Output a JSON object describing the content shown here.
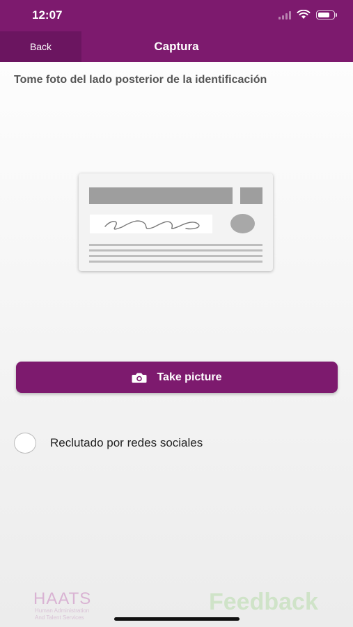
{
  "status_bar": {
    "time": "12:07",
    "signal_bars_filled": 0,
    "battery_level": 0.8
  },
  "nav": {
    "back_label": "Back",
    "title": "Captura"
  },
  "instruction": "Tome foto del lado posterior de la identificación",
  "illustration": {
    "icon": "id-card-back-icon"
  },
  "take_picture": {
    "label": "Take picture",
    "icon": "camera-icon"
  },
  "checkbox": {
    "label": "Reclutado por redes sociales",
    "checked": false
  },
  "footer": {
    "haats_name": "HAATS",
    "haats_tagline_1": "Human Administration",
    "haats_tagline_2": "And Talent Services",
    "feedback_brand": "Feedback"
  },
  "colors": {
    "brand_purple": "#7d1a6e",
    "back_button": "#6b1560",
    "feedback_green": "#cfe3c8"
  }
}
